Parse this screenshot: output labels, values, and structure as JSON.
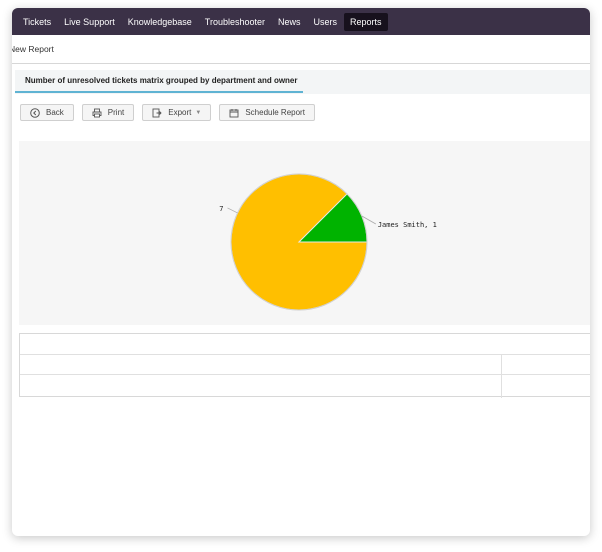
{
  "nav": {
    "items": [
      "Tickets",
      "Live Support",
      "Knowledgebase",
      "Troubleshooter",
      "News",
      "Users",
      "Reports"
    ],
    "active": "Reports"
  },
  "page": {
    "subtitle": "New Report",
    "report_title": "Number of unresolved tickets matrix grouped by department and owner"
  },
  "toolbar": {
    "back": "Back",
    "print": "Print",
    "export": "Export",
    "schedule": "Schedule Report"
  },
  "chart_data": {
    "type": "pie",
    "slices": [
      {
        "label": "7",
        "value": 7,
        "color": "#ffbf00"
      },
      {
        "label": "James Smith, 1",
        "value": 1,
        "color": "#00b300"
      }
    ],
    "title": "",
    "legend": "none"
  }
}
